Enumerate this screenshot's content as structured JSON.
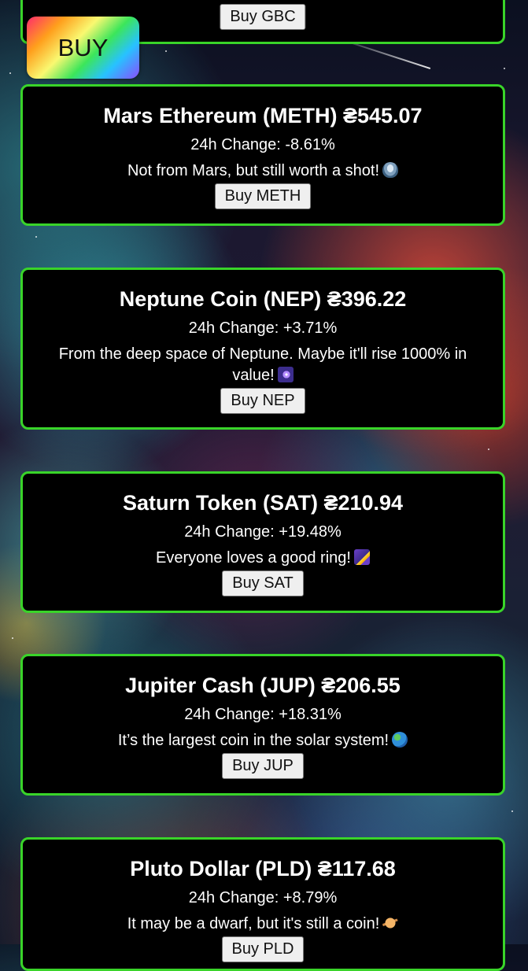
{
  "floating_buy": {
    "label": "BUY",
    "gradient_colors": [
      "#ff2a6d",
      "#ff9f1c",
      "#f9f871",
      "#3ce65a",
      "#27c2ff",
      "#8a4dff"
    ]
  },
  "theme": {
    "card_background": "#000000",
    "card_border": "#39d429",
    "text": "#ffffff",
    "button_background": "#efefef"
  },
  "partial_top_card": {
    "buy_label": "Buy GBC"
  },
  "coins": [
    {
      "title": "Mars Ethereum (METH) ₴545.07",
      "change": "24h Change: -8.61%",
      "tagline": "Not from Mars, but still worth a shot!",
      "emoji": "flying-saucer",
      "buy_label": "Buy METH"
    },
    {
      "title": "Neptune Coin (NEP) ₴396.22",
      "change": "24h Change: +3.71%",
      "tagline": "From the deep space of Neptune. Maybe it'll rise 1000% in value!",
      "emoji": "milky-way",
      "buy_label": "Buy NEP"
    },
    {
      "title": "Saturn Token (SAT) ₴210.94",
      "change": "24h Change: +19.48%",
      "tagline": "Everyone loves a good ring!",
      "emoji": "shooting-star",
      "buy_label": "Buy SAT"
    },
    {
      "title": "Jupiter Cash (JUP) ₴206.55",
      "change": "24h Change: +18.31%",
      "tagline": "It’s the largest coin in the solar system!",
      "emoji": "globe",
      "buy_label": "Buy JUP"
    },
    {
      "title": "Pluto Dollar (PLD) ₴117.68",
      "change": "24h Change: +8.79%",
      "tagline": "It may be a dwarf, but it's still a coin!",
      "emoji": "ringed-planet",
      "buy_label": "Buy PLD"
    }
  ]
}
